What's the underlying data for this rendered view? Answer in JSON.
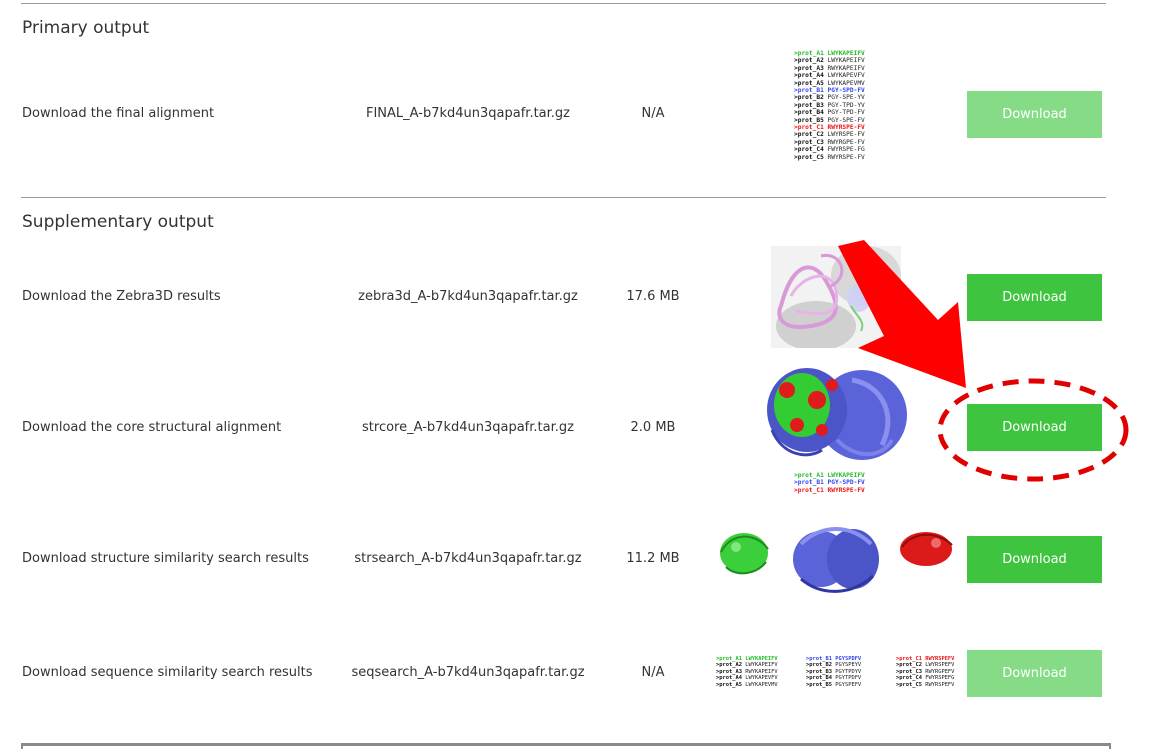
{
  "primary": {
    "title": "Primary output",
    "row": {
      "label": "Download the final alignment",
      "file": "FINAL_A-b7kd4un3qapafr.tar.gz",
      "size": "N/A",
      "button": "Download",
      "alignment": [
        {
          "name": ">prot_A1",
          "seq": "LWYKAPEIFV",
          "color": "g"
        },
        {
          "name": ">prot_A2",
          "seq": "LWYKAPEIFV",
          "color": "k"
        },
        {
          "name": ">prot_A3",
          "seq": "RWYKAPEIFV",
          "color": "k"
        },
        {
          "name": ">prot_A4",
          "seq": "LWYKAPEVFV",
          "color": "k"
        },
        {
          "name": ">prot_A5",
          "seq": "LWYKAPEVMV",
          "color": "k"
        },
        {
          "name": ">prot_B1",
          "seq": "PGY-SPD-FV",
          "color": "b"
        },
        {
          "name": ">prot_B2",
          "seq": "PGY-SPE-YV",
          "color": "k"
        },
        {
          "name": ">prot_B3",
          "seq": "PGY-TPD-YV",
          "color": "k"
        },
        {
          "name": ">prot_B4",
          "seq": "PGY-TPD-FV",
          "color": "k"
        },
        {
          "name": ">prot_B5",
          "seq": "PGY-SPE-FV",
          "color": "k"
        },
        {
          "name": ">prot_C1",
          "seq": "RWYRSPE-FV",
          "color": "r"
        },
        {
          "name": ">prot_C2",
          "seq": "LWYRSPE-FV",
          "color": "k"
        },
        {
          "name": ">prot_C3",
          "seq": "RWYRGPE-FV",
          "color": "k"
        },
        {
          "name": ">prot_C4",
          "seq": "FWYRSPE-FG",
          "color": "k"
        },
        {
          "name": ">prot_C5",
          "seq": "RWYRSPE-FV",
          "color": "k"
        }
      ]
    }
  },
  "supplementary": {
    "title": "Supplementary output",
    "rows": [
      {
        "label": "Download the Zebra3D results",
        "file": "zebra3d_A-b7kd4un3qapafr.tar.gz",
        "size": "17.6 MB",
        "button": "Download"
      },
      {
        "label": "Download the core structural alignment",
        "file": "strcore_A-b7kd4un3qapafr.tar.gz",
        "size": "2.0 MB",
        "button": "Download",
        "alignment": [
          {
            "name": ">prot_A1",
            "seq": "LWYKAPEIFV",
            "color": "g"
          },
          {
            "name": ">prot_B1",
            "seq": "PGY-SPD-FV",
            "color": "b"
          },
          {
            "name": ">prot_C1",
            "seq": "RWYRSPE-FV",
            "color": "r"
          }
        ]
      },
      {
        "label": "Download structure similarity search results",
        "file": "strsearch_A-b7kd4un3qapafr.tar.gz",
        "size": "11.2 MB",
        "button": "Download"
      },
      {
        "label": "Download sequence similarity search results",
        "file": "seqsearch_A-b7kd4un3qapafr.tar.gz",
        "size": "N/A",
        "button": "Download",
        "alignments": [
          [
            {
              "name": ">prot_A1",
              "seq": "LWYKAPEIFV",
              "color": "g"
            },
            {
              "name": ">prot_A2",
              "seq": "LWYKAPEIFV",
              "color": "k"
            },
            {
              "name": ">prot_A3",
              "seq": "RWYKAPEIFV",
              "color": "k"
            },
            {
              "name": ">prot_A4",
              "seq": "LWYKAPEVFV",
              "color": "k"
            },
            {
              "name": ">prot_A5",
              "seq": "LWYKAPEVMV",
              "color": "k"
            }
          ],
          [
            {
              "name": ">prot_B1",
              "seq": "PGYSPDFV",
              "color": "b"
            },
            {
              "name": ">prot_B2",
              "seq": "PGYSPEYV",
              "color": "k"
            },
            {
              "name": ">prot_B3",
              "seq": "PGYTPDYV",
              "color": "k"
            },
            {
              "name": ">prot_B4",
              "seq": "PGYTPDFV",
              "color": "k"
            },
            {
              "name": ">prot_B5",
              "seq": "PGYSPEFV",
              "color": "k"
            }
          ],
          [
            {
              "name": ">prot_C1",
              "seq": "RWYRSPEFV",
              "color": "r"
            },
            {
              "name": ">prot_C2",
              "seq": "LWYRSPEFV",
              "color": "k"
            },
            {
              "name": ">prot_C3",
              "seq": "RWYRGPEFV",
              "color": "k"
            },
            {
              "name": ">prot_C4",
              "seq": "FWYRSPEFG",
              "color": "k"
            },
            {
              "name": ">prot_C5",
              "seq": "RWYRSPEFV",
              "color": "k"
            }
          ]
        ]
      }
    ]
  },
  "colors": {
    "button_light": "#86dc86",
    "button_strong": "#3ec43e",
    "annotation": "#ee0000"
  },
  "icons": [
    "protein-structure-image",
    "red-arrow-annotation",
    "dashed-ellipse-annotation"
  ]
}
